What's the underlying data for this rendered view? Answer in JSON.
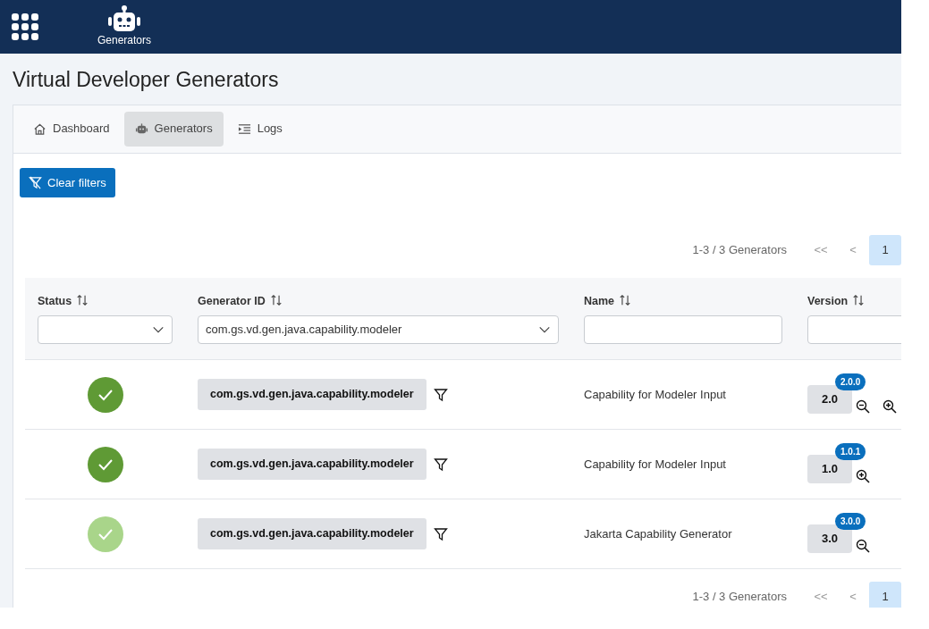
{
  "topbar": {
    "app_label": "Generators"
  },
  "page_title": "Virtual Developer Generators",
  "tabs": [
    {
      "label": "Dashboard",
      "kind": "home",
      "selected": false
    },
    {
      "label": "Generators",
      "kind": "robot",
      "selected": true
    },
    {
      "label": "Logs",
      "kind": "logs",
      "selected": false
    }
  ],
  "clear_filters": "Clear filters",
  "pagination_top": {
    "summary": "1-3 / 3 Generators",
    "first": "<<",
    "prev": "<",
    "pages": [
      {
        "label": "1",
        "selected": true
      }
    ]
  },
  "table": {
    "columns": [
      {
        "label": "Status",
        "kind": "select"
      },
      {
        "label": "Generator ID",
        "kind": "select",
        "value": "com.gs.vd.gen.java.capability.modeler"
      },
      {
        "label": "Name",
        "kind": "text"
      },
      {
        "label": "Version",
        "kind": "text"
      }
    ],
    "rows": [
      {
        "enabled": true,
        "generator_id": "com.gs.vd.gen.java.capability.modeler",
        "name": "Capability for Modeler Input",
        "version": "2.0",
        "full_version": "2.0.0",
        "actions": [
          {
            "kind": "zoom-out"
          },
          {
            "kind": "zoom-in"
          }
        ]
      },
      {
        "enabled": true,
        "generator_id": "com.gs.vd.gen.java.capability.modeler",
        "name": "Capability for Modeler Input",
        "version": "1.0",
        "full_version": "1.0.1",
        "actions": [
          {
            "kind": "zoom-in"
          }
        ]
      },
      {
        "enabled": false,
        "generator_id": "com.gs.vd.gen.java.capability.modeler",
        "name": "Jakarta Capability Generator",
        "version": "3.0",
        "full_version": "3.0.0",
        "actions": [
          {
            "kind": "zoom-out"
          }
        ]
      }
    ]
  },
  "pagination_bottom": {
    "summary": "1-3 / 3 Generators",
    "first": "<<",
    "prev": "<",
    "pages": [
      {
        "label": "1",
        "selected": true
      }
    ]
  }
}
